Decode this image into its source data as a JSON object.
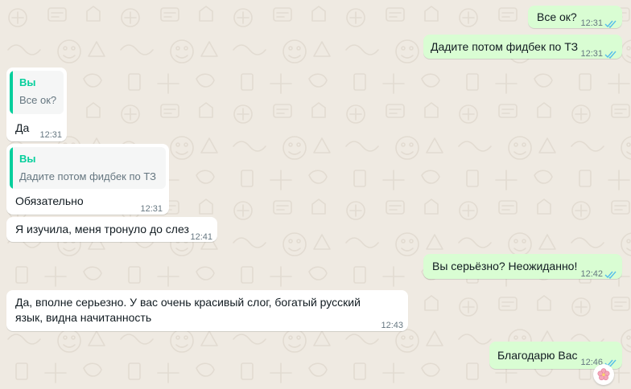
{
  "colors": {
    "chat_background": "#efeae2",
    "incoming_bubble": "#ffffff",
    "outgoing_bubble": "#d9fdd3",
    "quote_accent": "#06cf9c",
    "read_ticks": "#53bdeb",
    "timestamp": "#667781"
  },
  "messages": [
    {
      "direction": "outgoing",
      "text": "Все ок?",
      "time": "12:31",
      "status": "read"
    },
    {
      "direction": "outgoing",
      "text": "Дадите потом фидбек по ТЗ",
      "time": "12:31",
      "status": "read"
    },
    {
      "direction": "incoming",
      "quote": {
        "author": "Вы",
        "text": "Все ок?"
      },
      "text": "Да",
      "time": "12:31"
    },
    {
      "direction": "incoming",
      "quote": {
        "author": "Вы",
        "text": "Дадите потом фидбек по ТЗ"
      },
      "text": "Обязательно",
      "time": "12:31"
    },
    {
      "direction": "incoming",
      "text": "Я изучила, меня тронуло до слез",
      "time": "12:41"
    },
    {
      "direction": "outgoing",
      "text": "Вы серьёзно? Неожиданно!",
      "time": "12:42",
      "status": "read"
    },
    {
      "direction": "incoming",
      "text": "Да, вполне серьезно. У вас очень красивый слог, богатый русский язык, видна начитанность",
      "time": "12:43"
    },
    {
      "direction": "outgoing",
      "text": "Благодарю Вас",
      "time": "12:46",
      "status": "read",
      "reaction": "cherry-blossom"
    }
  ]
}
